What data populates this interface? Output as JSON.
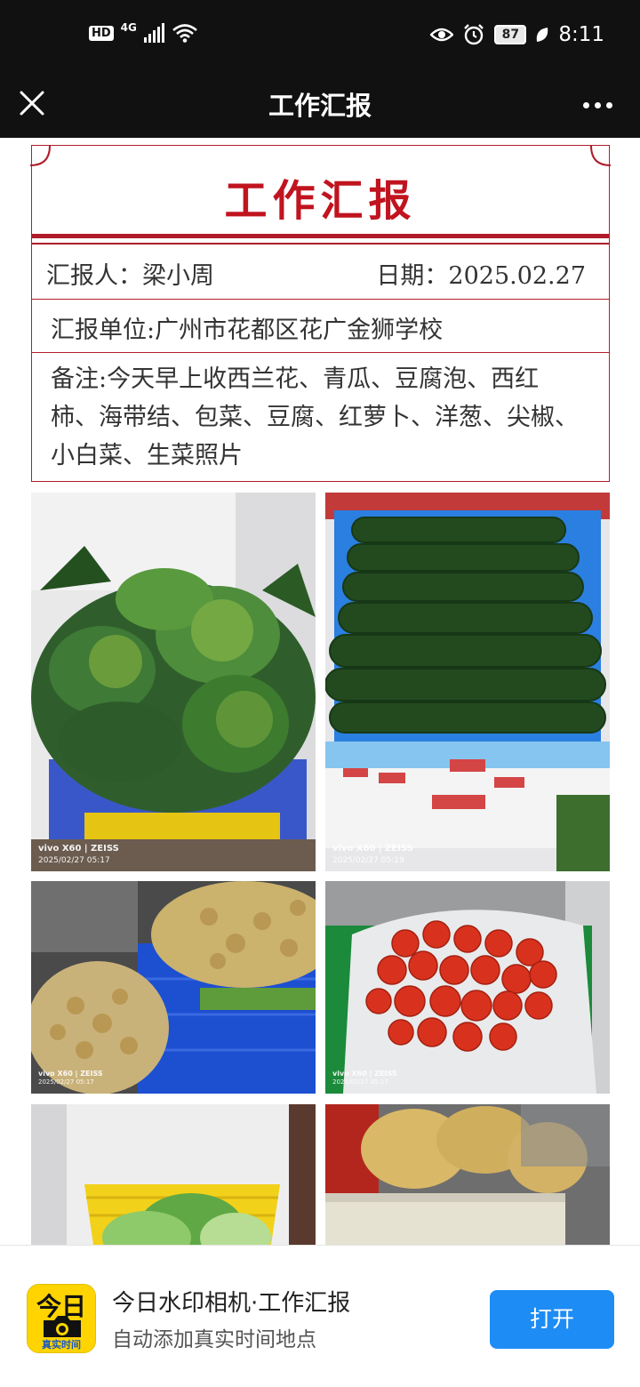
{
  "status_bar": {
    "hd_badge": "HD",
    "network": "4G",
    "battery": "87",
    "time": "8:11"
  },
  "app_bar": {
    "title": "工作汇报"
  },
  "report": {
    "heading": "工作汇报",
    "reporter": "汇报人：梁小周",
    "date": "日期：2025.02.27",
    "unit": "汇报单位:广州市花都区花广金狮学校",
    "notes": "备注:今天早上收西兰花、青瓜、豆腐泡、西红柿、海带结、包菜、豆腐、红萝卜、洋葱、尖椒、小白菜、生菜照片"
  },
  "photos": [
    {
      "subject": "broccoli-and-greens",
      "watermark_model": "vivo X60 | ZEISS",
      "watermark_time": "2025/02/27 05:17"
    },
    {
      "subject": "cucumbers",
      "watermark_model": "vivo X60 | ZEISS",
      "watermark_time": "2025/02/27 05:19"
    },
    {
      "subject": "tofu-puffs",
      "watermark_model": "vivo X60 | ZEISS",
      "watermark_time": "2025/02/27 05:17"
    },
    {
      "subject": "tomatoes",
      "watermark_model": "vivo X60 | ZEISS",
      "watermark_time": "2025/02/27 05:17"
    },
    {
      "subject": "cabbage"
    },
    {
      "subject": "kelp-knots-and-tofu"
    }
  ],
  "banner": {
    "logo_top": "今日",
    "logo_bottom": "真实时间",
    "title": "今日水印相机·工作汇报",
    "subtitle": "自动添加真实时间地点",
    "open_button": "打开"
  },
  "colors": {
    "report_red": "#c0141f",
    "open_button_blue": "#1e8cf5",
    "logo_yellow": "#ffd400",
    "bar_black": "#111111"
  }
}
